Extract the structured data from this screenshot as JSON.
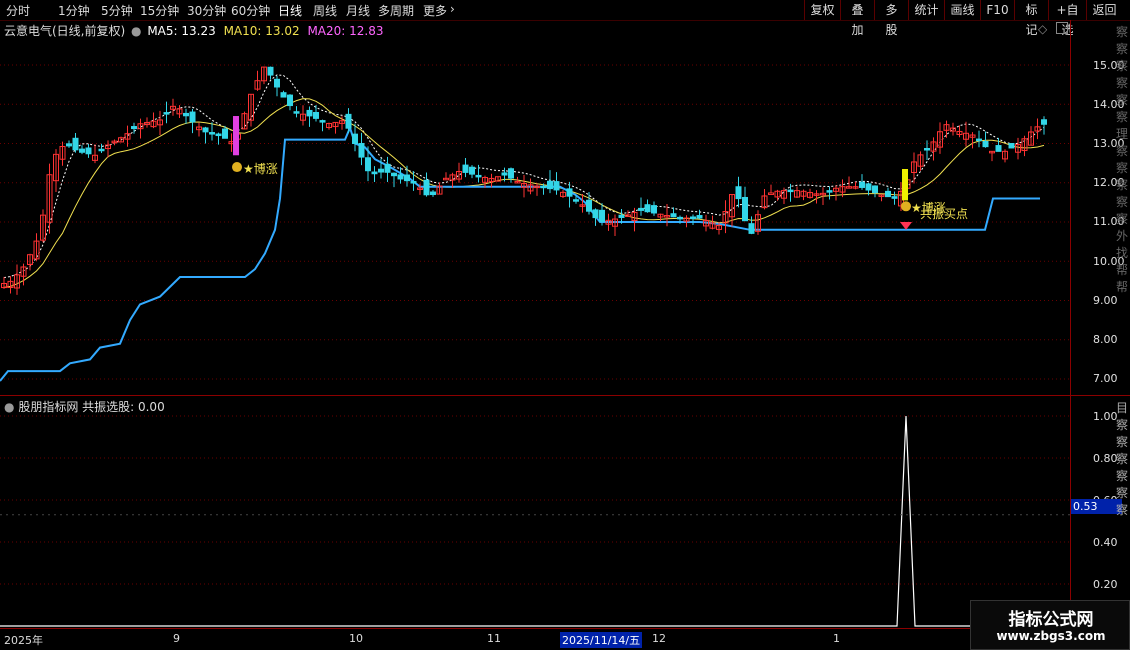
{
  "toolbar": {
    "timeframes": [
      "分时",
      "1分钟",
      "5分钟",
      "15分钟",
      "30分钟",
      "60分钟",
      "日线",
      "周线",
      "月线",
      "多周期",
      "更多"
    ],
    "active_index": 6,
    "more_arrow": "›",
    "buttons": [
      "复权",
      "叠加",
      "多股",
      "统计",
      "画线",
      "F10",
      "标记",
      "+自选",
      "返回"
    ]
  },
  "main": {
    "stock": "云意电气(日线,前复权)",
    "ma5": "MA5: 13.23",
    "ma10": "MA10: 13.02",
    "ma20": "MA20: 12.83",
    "y_labels": [
      "15.00",
      "14.00",
      "13.00",
      "12.00",
      "11.00",
      "10.00",
      "9.00",
      "8.00",
      "7.00"
    ],
    "signal_label_1": "★博涨",
    "signal_label_2": "★博涨",
    "signal_label_3": "共振买点",
    "colors": {
      "up": "#ff3333",
      "down": "#33d6e8",
      "ma5": "#ffffff",
      "ma10": "#f0e050",
      "support": "#33aaff",
      "pink": "#e040e0",
      "yellow": "#f0f000"
    }
  },
  "sub": {
    "title": "股朋指标网 共振选股: 0.00",
    "y_labels": [
      "1.00",
      "0.80",
      "0.60",
      "0.40",
      "0.20"
    ],
    "cursor_value": "0.53"
  },
  "dates": [
    "2025年",
    "9",
    "10",
    "11",
    "2025/11/14/五",
    "12",
    "1"
  ],
  "watermark": {
    "title": "指标公式网",
    "url": "www.zbgs3.com"
  },
  "side_text": "察察察察察察理察察察察察外找帮帮",
  "sub_side_text": "目察察察察察察"
}
